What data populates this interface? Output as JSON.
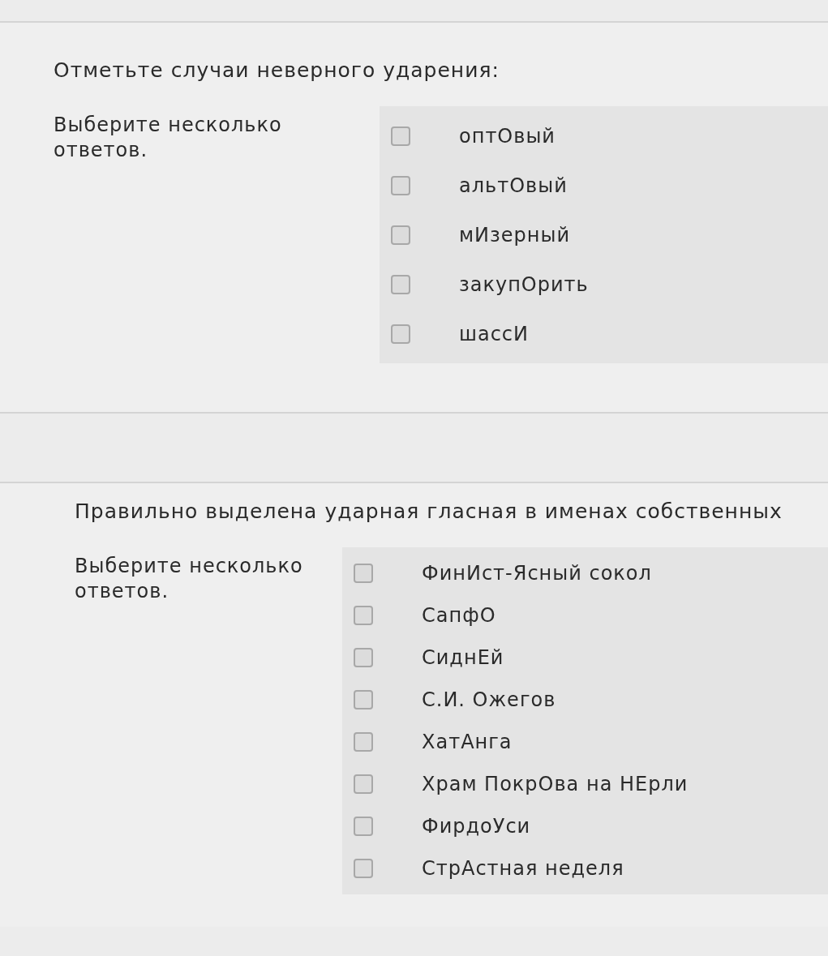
{
  "questions": [
    {
      "text": "Отметьте случаи неверного ударения:",
      "prompt": "Выберите несколько ответов.",
      "options": [
        {
          "label": "оптОвый",
          "checked": false
        },
        {
          "label": "альтОвый",
          "checked": false
        },
        {
          "label": "мИзерный",
          "checked": false
        },
        {
          "label": "закупОрить",
          "checked": false
        },
        {
          "label": "шассИ",
          "checked": false
        }
      ]
    },
    {
      "text": "Правильно выделена ударная гласная в именах собственных",
      "prompt": "Выберите несколько ответов.",
      "options": [
        {
          "label": "ФинИст-Ясный сокол",
          "checked": false
        },
        {
          "label": "СапфО",
          "checked": false
        },
        {
          "label": "СиднЕй",
          "checked": false
        },
        {
          "label": "С.И. Ожегов",
          "checked": false
        },
        {
          "label": "ХатАнга",
          "checked": false
        },
        {
          "label": "Храм ПокрОва на НЕрли",
          "checked": false
        },
        {
          "label": "ФирдоУси",
          "checked": false
        },
        {
          "label": "СтрАстная неделя",
          "checked": false
        }
      ]
    }
  ]
}
